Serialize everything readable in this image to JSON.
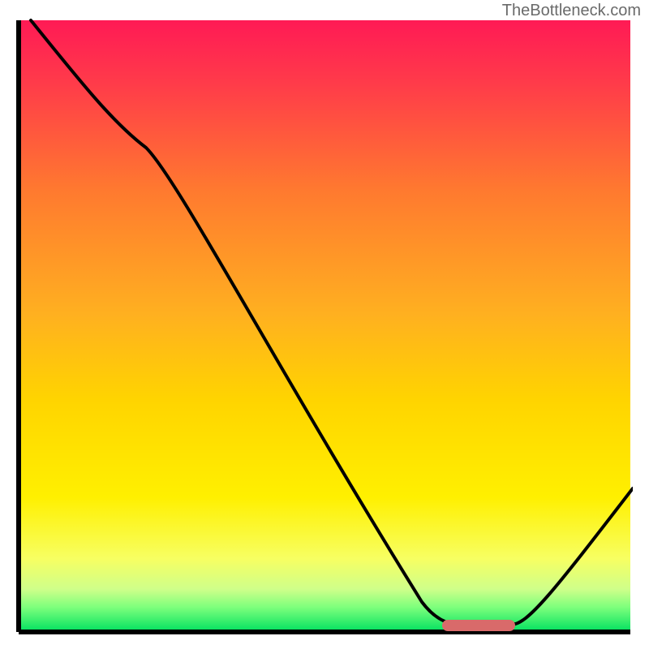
{
  "watermark": "TheBottleneck.com",
  "colors": {
    "gradient_top": "#ff1a55",
    "gradient_mid_upper": "#ff7a2f",
    "gradient_mid": "#ffd400",
    "gradient_lower": "#f7ff62",
    "gradient_green_light": "#7cff7c",
    "gradient_green": "#00e060",
    "axis": "#000000",
    "curve": "#000000",
    "flat_marker": "#d96a6a"
  },
  "chart_data": {
    "type": "line",
    "title": "",
    "xlabel": "",
    "ylabel": "",
    "xlim": [
      0,
      100
    ],
    "ylim": [
      0,
      100
    ],
    "legend": false,
    "grid": false,
    "background": "red-yellow-green vertical gradient (bottleneck heatmap)",
    "series": [
      {
        "name": "bottleneck-curve",
        "x": [
          2,
          20,
          65,
          72,
          80,
          100
        ],
        "y": [
          100,
          80,
          4,
          1,
          1,
          24
        ],
        "note": "Curve descends steeply from top-left, kinks near x≈20, reaches a flat minimum plateau around x≈68–80, then rises toward the right edge."
      }
    ],
    "annotations": [
      {
        "name": "optimal-flat-segment",
        "type": "horizontal-bar",
        "x_start": 68,
        "x_end": 80,
        "y": 1,
        "color": "#d96a6a",
        "thickness_px": 12,
        "description": "Short rounded red bar marking the flat minimum of the curve."
      }
    ]
  }
}
